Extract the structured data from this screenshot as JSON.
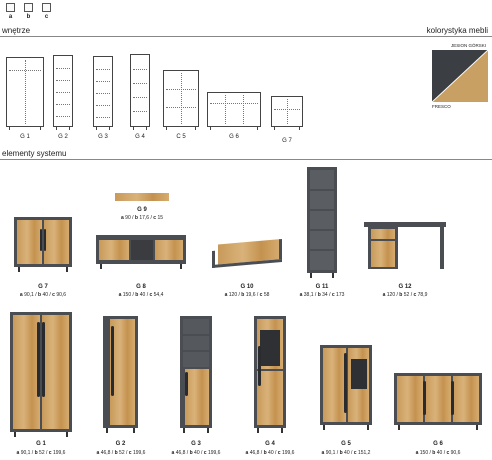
{
  "cubes": [
    {
      "label": "a"
    },
    {
      "label": "b"
    },
    {
      "label": "c"
    }
  ],
  "section_interiors": "wnętrze",
  "section_colors": "kolorystyka mebli",
  "section_elements": "elementy systemu",
  "swatch": {
    "top_label": "JESION GÓRSKI",
    "bottom_label": "FRESCO",
    "colors": {
      "oak": "#c9a063",
      "dark": "#3b3e42"
    }
  },
  "interiors": [
    {
      "label": "G 1"
    },
    {
      "label": "G 2"
    },
    {
      "label": "G 3"
    },
    {
      "label": "G 4"
    },
    {
      "label": "C 5"
    },
    {
      "label": "G 6"
    },
    {
      "label": "G 7"
    }
  ],
  "elements_row1": [
    {
      "label": "G 7",
      "a": "90,1",
      "b": "40",
      "c": "90,6"
    },
    {
      "label": "G 8",
      "a": "150",
      "b": "40",
      "c": "54,4"
    },
    {
      "label": "G 9",
      "a": "90",
      "b": "17,6",
      "c": "15"
    },
    {
      "label": "G 10",
      "a": "120",
      "b": "19,6",
      "c": "58"
    },
    {
      "label": "G 11",
      "a": "38,1",
      "b": "34",
      "c": "173"
    },
    {
      "label": "G 12",
      "a": "120",
      "b": "52",
      "c": "78,9"
    }
  ],
  "elements_row2": [
    {
      "label": "G 1",
      "a": "90,1",
      "b": "52",
      "c": "199,6"
    },
    {
      "label": "G 2",
      "a": "46,8",
      "b": "52",
      "c": "199,6"
    },
    {
      "label": "G 3",
      "a": "46,8",
      "b": "40",
      "c": "199,6"
    },
    {
      "label": "G 4",
      "a": "46,8",
      "b": "40",
      "c": "199,6"
    },
    {
      "label": "G 5",
      "a": "90,1",
      "b": "40",
      "c": "151,2"
    },
    {
      "label": "G 6",
      "a": "150",
      "b": "40",
      "c": "90,6"
    }
  ]
}
